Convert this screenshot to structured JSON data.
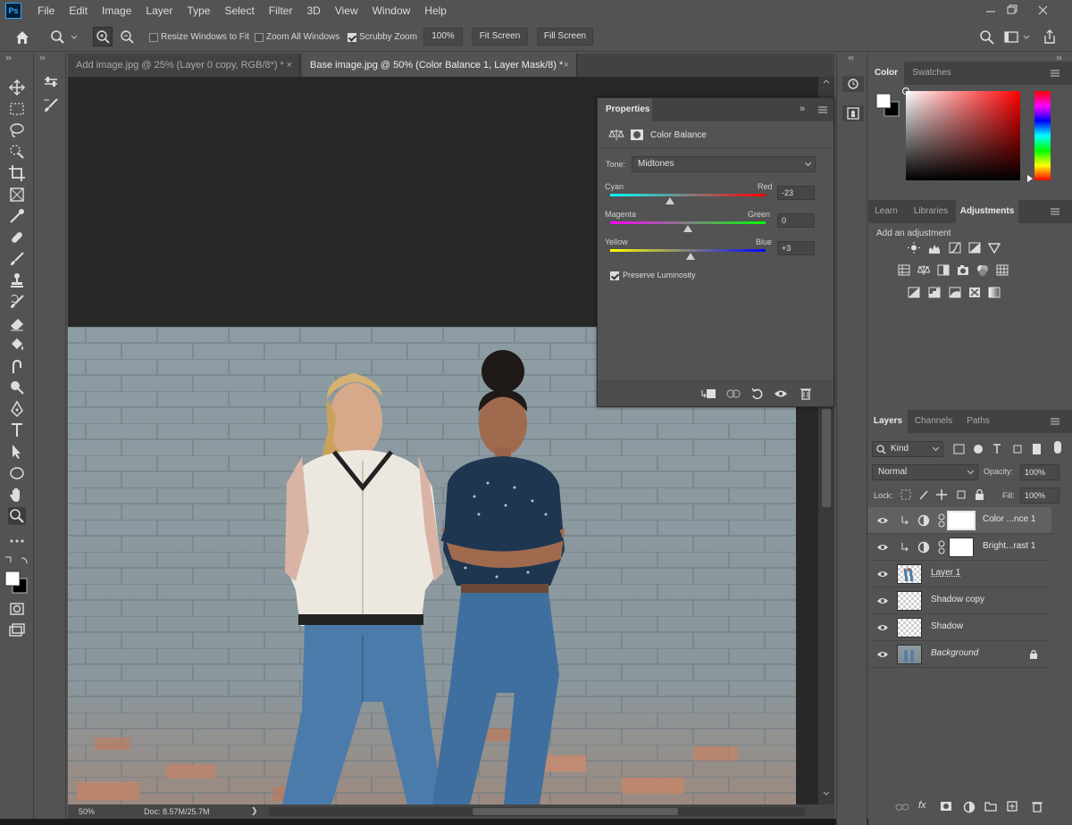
{
  "app": {
    "logo": "Ps"
  },
  "menu": [
    "File",
    "Edit",
    "Image",
    "Layer",
    "Type",
    "Select",
    "Filter",
    "3D",
    "View",
    "Window",
    "Help"
  ],
  "options_bar": {
    "resize_windows_label": "Resize Windows to Fit",
    "resize_windows_checked": false,
    "zoom_all_label": "Zoom All Windows",
    "zoom_all_checked": false,
    "scrubby_label": "Scrubby Zoom",
    "scrubby_checked": true,
    "zoom_100_label": "100%",
    "fit_screen_label": "Fit Screen",
    "fill_screen_label": "Fill Screen"
  },
  "tabs": [
    {
      "label": "Add image.jpg @ 25% (Layer 0 copy, RGB/8*) *",
      "close": "×",
      "active": false
    },
    {
      "label": "Base image.jpg @ 50% (Color Balance 1, Layer Mask/8) *",
      "close": "×",
      "active": true
    }
  ],
  "status": {
    "zoom": "50%",
    "doc": "Doc: 8.57M/25.7M",
    "arrow": "❯"
  },
  "properties": {
    "tab_label": "Properties",
    "collapse": "»",
    "title": "Color Balance",
    "tone_label": "Tone:",
    "tone_value": "Midtones",
    "sliders": [
      {
        "left": "Cyan",
        "right": "Red",
        "value": "-23",
        "level": 0.385,
        "colors": [
          "#00ffff",
          "#ff0000"
        ]
      },
      {
        "left": "Magenta",
        "right": "Green",
        "value": "0",
        "level": 0.5,
        "colors": [
          "#ff00ff",
          "#00ff00"
        ]
      },
      {
        "left": "Yellow",
        "right": "Blue",
        "value": "+3",
        "level": 0.515,
        "colors": [
          "#ffff00",
          "#0000ff"
        ]
      }
    ],
    "preserve_luminosity": "Preserve Luminosity",
    "preserve_checked": true
  },
  "color_panel": {
    "tabs": [
      "Color",
      "Swatches"
    ],
    "foreground": "#ffffff",
    "background": "#000000"
  },
  "adjust_panel": {
    "tabs": [
      "Learn",
      "Libraries",
      "Adjustments"
    ],
    "add_label": "Add an adjustment",
    "icons_row1": [
      "brightness-contrast-icon",
      "levels-icon",
      "curves-icon",
      "exposure-icon",
      "vibrance-icon"
    ],
    "icons_row2": [
      "hue-saturation-icon",
      "color-balance-icon",
      "black-white-icon",
      "photo-filter-icon",
      "channel-mixer-icon",
      "color-lookup-icon"
    ],
    "icons_row3": [
      "invert-icon",
      "posterize-icon",
      "threshold-icon",
      "selective-color-icon",
      "gradient-map-icon"
    ]
  },
  "layers_panel": {
    "tabs": [
      "Layers",
      "Channels",
      "Paths"
    ],
    "kind_label": "Kind",
    "blend_mode": "Normal",
    "opacity_label": "Opacity:",
    "opacity_value": "100%",
    "lock_label": "Lock:",
    "fill_label": "Fill:",
    "fill_value": "100%",
    "layers": [
      {
        "name": "Color ...nce 1",
        "type": "adjustment",
        "selected": true
      },
      {
        "name": "Bright...rast 1",
        "type": "adjustment",
        "selected": false
      },
      {
        "name": "Layer 1",
        "type": "pixel",
        "selected": false
      },
      {
        "name": "Shadow copy",
        "type": "transparent",
        "selected": false
      },
      {
        "name": "Shadow",
        "type": "transparent",
        "selected": false
      },
      {
        "name": "Background",
        "type": "background",
        "selected": false
      }
    ]
  }
}
